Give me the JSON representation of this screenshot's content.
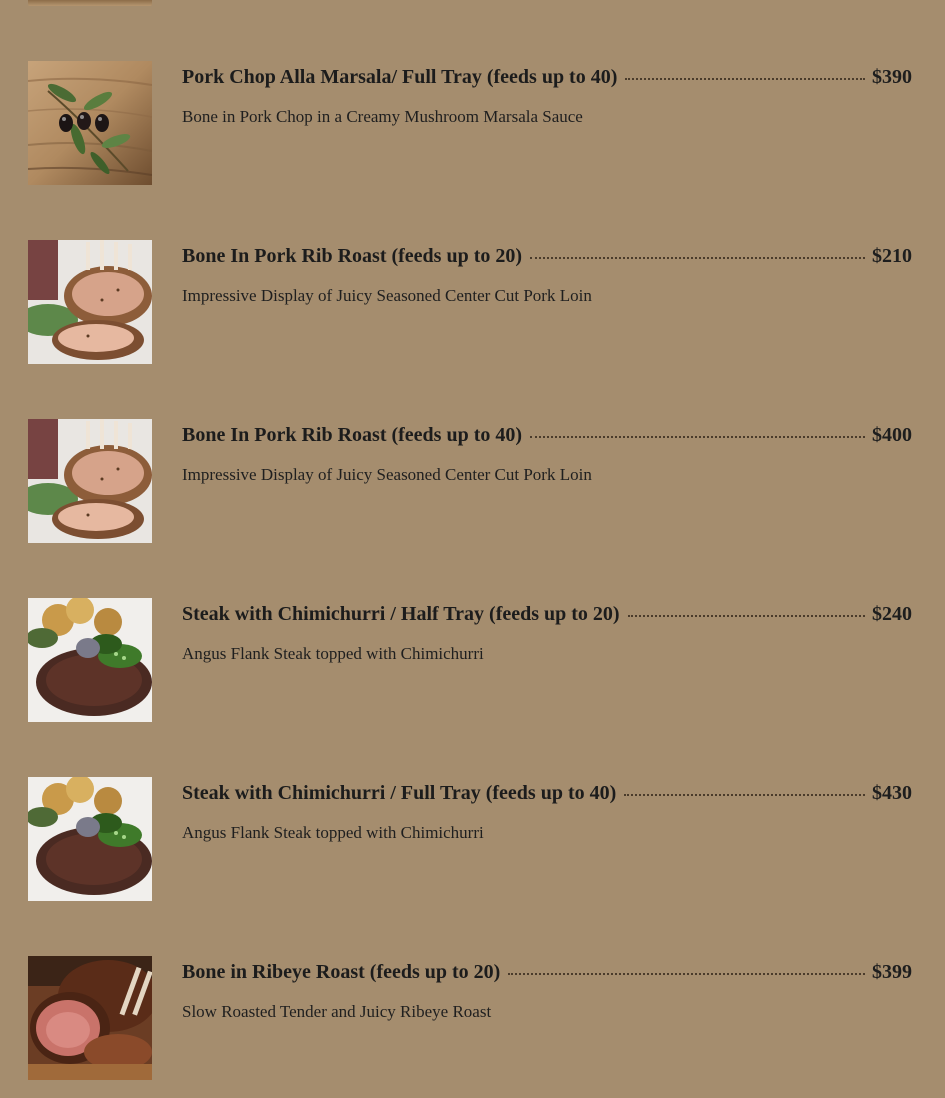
{
  "menu": {
    "items": [
      {
        "name": "Pork Chop Alla Marsala/ Full Tray (feeds up to 40)",
        "price": "$390",
        "description": "Bone in Pork Chop in a Creamy Mushroom Marsala Sauce",
        "image": "olive-branch-on-wood"
      },
      {
        "name": "Bone In Pork Rib Roast (feeds up to 20)",
        "price": "$210",
        "description": "Impressive Display of Juicy Seasoned Center Cut Pork Loin",
        "image": "pork-rib-roast"
      },
      {
        "name": "Bone In Pork Rib Roast (feeds up to 40)",
        "price": "$400",
        "description": "Impressive Display of Juicy Seasoned Center Cut Pork Loin",
        "image": "pork-rib-roast"
      },
      {
        "name": "Steak with Chimichurri / Half Tray (feeds up to 20)",
        "price": "$240",
        "description": "Angus Flank Steak topped with Chimichurri",
        "image": "steak-chimichurri"
      },
      {
        "name": "Steak with Chimichurri / Full Tray (feeds up to 40)",
        "price": "$430",
        "description": "Angus Flank Steak topped with Chimichurri",
        "image": "steak-chimichurri"
      },
      {
        "name": "Bone in Ribeye Roast (feeds up to 20)",
        "price": "$399",
        "description": "Slow Roasted Tender and Juicy Ribeye Roast",
        "image": "ribeye-roast"
      }
    ]
  },
  "colors": {
    "background": "#a58d6e",
    "text": "#1e1e1e"
  }
}
